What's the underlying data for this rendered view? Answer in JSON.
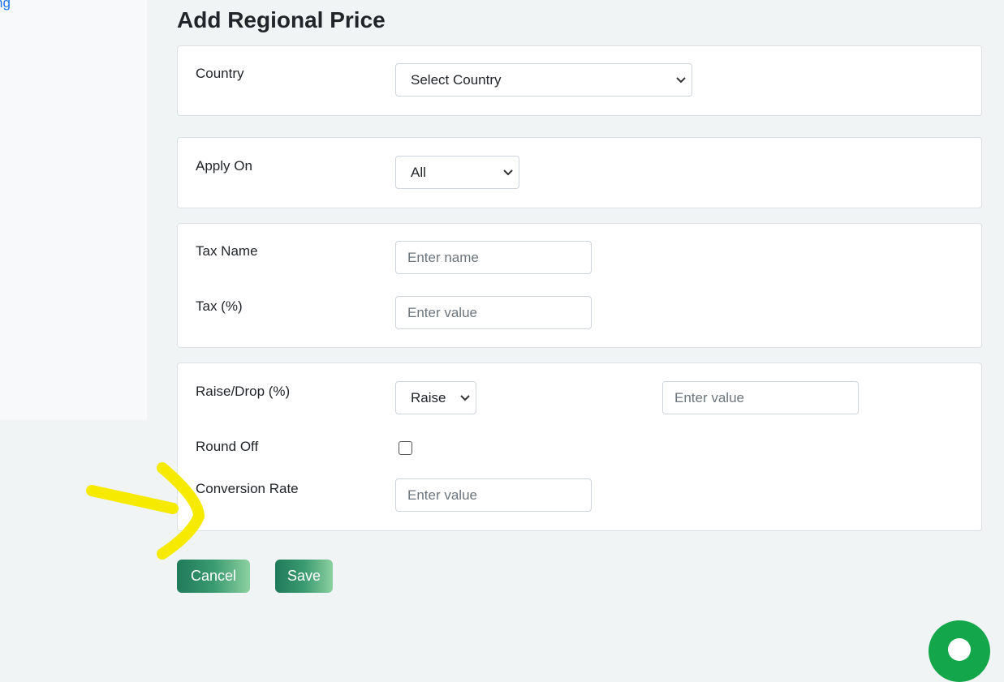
{
  "sidebar": {
    "link_fragment": "ng"
  },
  "page": {
    "title": "Add Regional Price"
  },
  "country_card": {
    "label": "Country",
    "select_value": "Select Country",
    "icon": "chevron-down-icon"
  },
  "apply_card": {
    "label": "Apply On",
    "select_value": "All",
    "icon": "chevron-down-icon"
  },
  "tax_card": {
    "tax_name_label": "Tax Name",
    "tax_name_placeholder": "Enter name",
    "tax_percent_label": "Tax (%)",
    "tax_percent_placeholder": "Enter value"
  },
  "price_card": {
    "raise_drop_label": "Raise/Drop (%)",
    "raise_drop_select": "Raise",
    "raise_drop_placeholder": "Enter value",
    "round_off_label": "Round Off",
    "round_off_checked": false,
    "conversion_rate_label": "Conversion Rate",
    "conversion_rate_placeholder": "Enter value"
  },
  "actions": {
    "cancel_label": "Cancel",
    "save_label": "Save"
  },
  "colors": {
    "button_gradient_start": "#1f7a5a",
    "button_gradient_end": "#8cd0a0",
    "annotation": "#f5ea00",
    "fab": "#14a64a"
  }
}
